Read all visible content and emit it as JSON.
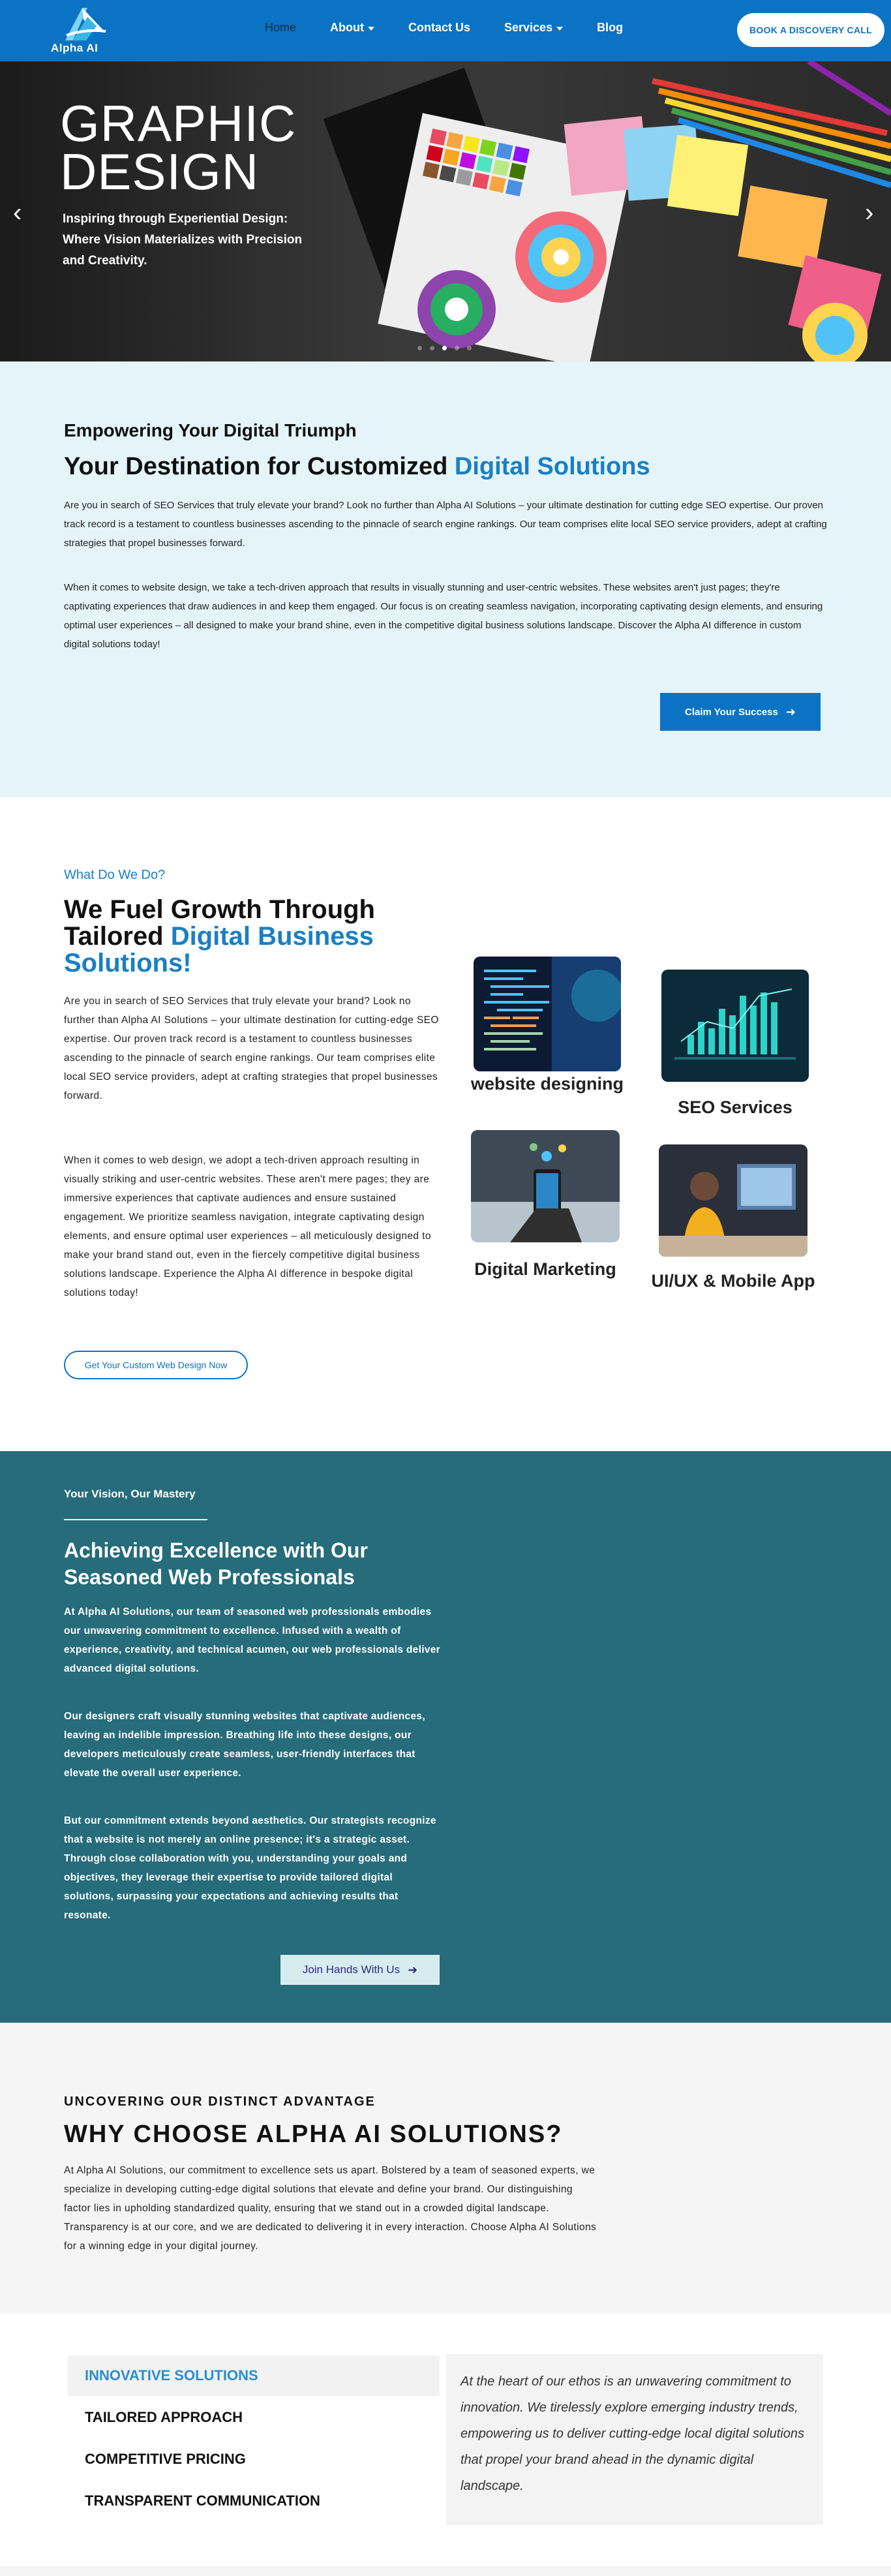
{
  "header": {
    "logo_text": "Alpha AI",
    "nav": [
      {
        "label": "Home",
        "active": true,
        "dropdown": false
      },
      {
        "label": "About",
        "active": false,
        "dropdown": true
      },
      {
        "label": "Contact Us",
        "active": false,
        "dropdown": false
      },
      {
        "label": "Services",
        "active": false,
        "dropdown": true
      },
      {
        "label": "Blog",
        "active": false,
        "dropdown": false
      }
    ],
    "cta_label": "BOOK A DISCOVERY CALL"
  },
  "hero": {
    "title_line1": "GRAPHIC",
    "title_line2": "DESIGN",
    "subtitle": "Inspiring through Experiential Design: Where Vision Materializes with Precision and Creativity.",
    "prev_icon": "chevron-left-icon",
    "next_icon": "chevron-right-icon",
    "slide_count": 5,
    "active_slide": 3
  },
  "intro": {
    "kicker": "Empowering Your Digital Triumph",
    "heading_plain": "Your Destination for Customized ",
    "heading_highlight": "Digital Solutions",
    "paragraph1": "Are you in search of SEO Services that truly elevate your brand? Look no further than Alpha AI Solutions – your ultimate destination for cutting edge SEO expertise. Our proven track record is a testament to countless businesses ascending to the pinnacle of search engine rankings. Our team comprises elite local SEO service providers, adept at crafting strategies that propel businesses forward.",
    "paragraph2": "When it comes to website design, we take a tech-driven approach that results in visually stunning and user-centric websites. These websites aren't just pages; they're captivating experiences that draw audiences in and keep them engaged. Our focus is on creating seamless navigation, incorporating captivating design elements, and ensuring optimal user experiences – all designed to make your brand shine, even in the competitive digital business solutions landscape. Discover the Alpha AI difference in custom digital solutions today!",
    "button_label": "Claim Your Success",
    "button_icon": "arrow-right-icon"
  },
  "services": {
    "kicker": "What Do We Do?",
    "heading_plain": "We Fuel Growth Through Tailored ",
    "heading_highlight": "Digital Business Solutions!",
    "paragraph1": "Are you in search of SEO Services that truly elevate your brand? Look no further than Alpha AI Solutions – your ultimate destination for cutting-edge SEO expertise. Our proven track record is a testament to countless businesses ascending to the pinnacle of search engine rankings. Our team comprises elite local SEO service providers, adept at crafting strategies that propel businesses forward.",
    "paragraph2": "When it comes to web design, we adopt a tech-driven approach resulting in visually striking and user-centric websites. These aren't mere pages; they are immersive experiences that captivate audiences and ensure sustained engagement. We prioritize seamless navigation, integrate captivating design elements, and ensure optimal user experiences – all meticulously designed to make your brand stand out, even in the fiercely competitive digital business solutions landscape. Experience the Alpha AI difference in bespoke digital solutions today!",
    "button_label": "Get Your Custom Web Design Now",
    "cards": [
      {
        "label": "website designing"
      },
      {
        "label": "SEO Services"
      },
      {
        "label": "Digital Marketing"
      },
      {
        "label": "UI/UX & Mobile App"
      }
    ]
  },
  "mastery": {
    "kicker": "Your Vision, Our Mastery",
    "heading": "Achieving Excellence with Our Seasoned Web Professionals",
    "paragraph1": "At Alpha AI Solutions, our team of seasoned web professionals embodies our unwavering commitment to excellence. Infused with a wealth of experience, creativity, and technical acumen, our web professionals deliver advanced digital solutions.",
    "paragraph2": "Our designers craft visually stunning websites that captivate audiences, leaving an indelible impression. Breathing life into these designs, our developers meticulously create seamless, user-friendly interfaces that elevate the overall user experience.",
    "paragraph3": "But our commitment extends beyond aesthetics. Our strategists recognize that a website is not merely an online presence; it's a strategic asset. Through close collaboration with you, understanding your goals and objectives, they leverage their expertise to provide tailored digital solutions, surpassing your expectations and achieving results that resonate.",
    "button_label": "Join Hands With Us",
    "button_icon": "arrow-right-icon"
  },
  "advantage": {
    "kicker": "UNCOVERING OUR DISTINCT ADVANTAGE",
    "heading": "WHY CHOOSE ALPHA AI SOLUTIONS?",
    "paragraph": "At Alpha AI Solutions, our commitment to excellence sets us apart. Bolstered by a team of seasoned experts, we specialize in developing cutting-edge digital solutions that elevate and define your brand. Our distinguishing factor lies in upholding standardized quality, ensuring that we stand out in a crowded digital landscape. Transparency is at our core, and we are dedicated to delivering it in every interaction. Choose Alpha AI Solutions for a winning edge in your digital journey."
  },
  "tabs": {
    "items": [
      {
        "label": "INNOVATIVE SOLUTIONS",
        "active": true
      },
      {
        "label": "TAILORED APPROACH",
        "active": false
      },
      {
        "label": "COMPETITIVE PRICING",
        "active": false
      },
      {
        "label": "TRANSPARENT COMMUNICATION",
        "active": false
      }
    ],
    "panel_text": "At the heart of our ethos is an unwavering commitment to innovation. We tirelessly explore emerging industry trends, empowering us to deliver cutting-edge local digital solutions that propel your brand ahead in the dynamic digital landscape."
  },
  "colors": {
    "brand_blue": "#0b73c3",
    "accent_blue": "#1a7fc4",
    "teal": "#266c7a",
    "light_cyan": "#e4f4f8"
  }
}
